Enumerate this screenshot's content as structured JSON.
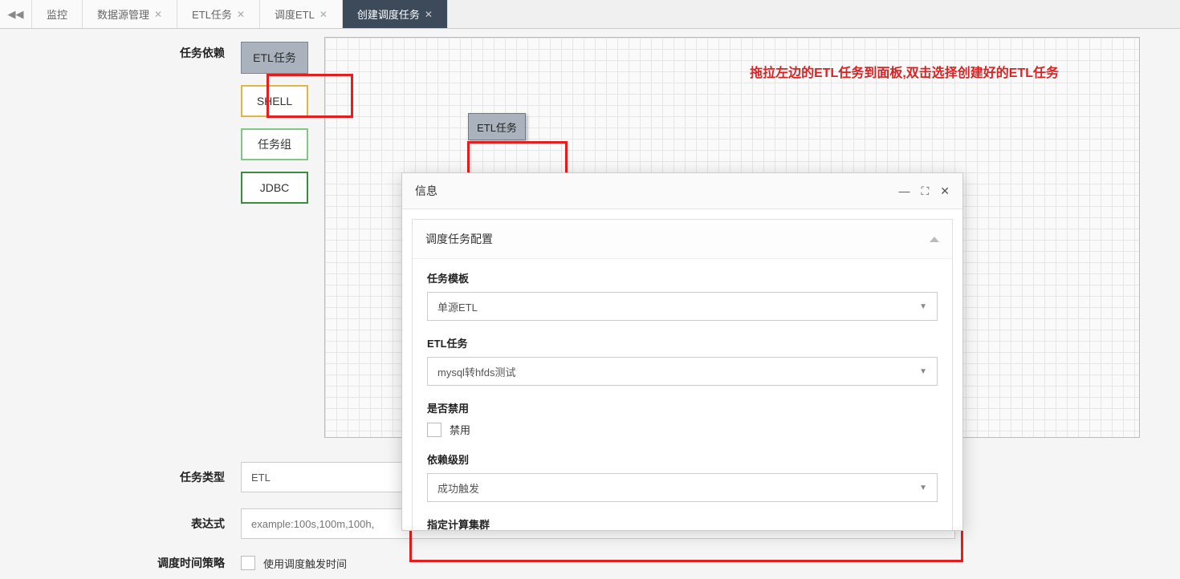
{
  "tabs": {
    "items": [
      {
        "label": "监控",
        "closable": false
      },
      {
        "label": "数据源管理",
        "closable": true
      },
      {
        "label": "ETL任务",
        "closable": true
      },
      {
        "label": "调度ETL",
        "closable": true
      },
      {
        "label": "创建调度任务",
        "closable": true,
        "active": true
      }
    ]
  },
  "form": {
    "depend_label": "任务依赖",
    "type_label": "任务类型",
    "type_value": "ETL",
    "expr_label": "表达式",
    "expr_placeholder": "example:100s,100m,100h,",
    "strategy_label": "调度时间策略",
    "strategy_checkbox": "使用调度触发时间"
  },
  "palette": {
    "etl": "ETL任务",
    "shell": "SHELL",
    "group": "任务组",
    "jdbc": "JDBC"
  },
  "canvas": {
    "node_label": "ETL任务",
    "banner": "拖拉左边的ETL任务到面板,双击选择创建好的ETL任务"
  },
  "modal": {
    "title": "信息",
    "panel_title": "调度任务配置",
    "fields": {
      "template_label": "任务模板",
      "template_value": "单源ETL",
      "etl_label": "ETL任务",
      "etl_value": "mysql转hfds测试",
      "disable_label": "是否禁用",
      "disable_checkbox": "禁用",
      "level_label": "依赖级别",
      "level_value": "成功触发",
      "cluster_label": "指定计算集群"
    }
  }
}
